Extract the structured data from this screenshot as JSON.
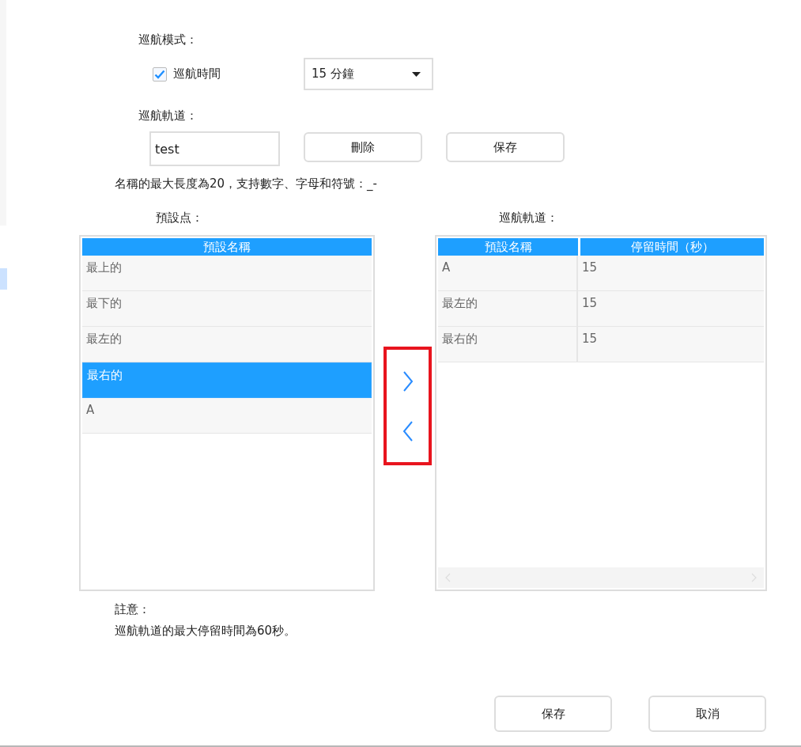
{
  "cruise_mode": {
    "label": "巡航模式：",
    "checkbox": {
      "label": "巡航時間",
      "checked": true
    },
    "duration": {
      "value": "15 分鐘"
    }
  },
  "cruise_track": {
    "label": "巡航軌道：",
    "name": {
      "value": "test"
    },
    "buttons": [
      "刪除",
      "保存"
    ],
    "hint": "名稱的最大長度為20，支持數字、字母和符號：_-"
  },
  "presets": {
    "label": "預設点：",
    "columns": [
      "預設名稱"
    ],
    "rows": [
      {
        "name": "最上的",
        "selected": false
      },
      {
        "name": "最下的",
        "selected": false
      },
      {
        "name": "最左的",
        "selected": false
      },
      {
        "name": "最右的",
        "selected": true
      },
      {
        "name": "A",
        "selected": false
      }
    ]
  },
  "track_table": {
    "label": "巡航軌道：",
    "columns": [
      "預設名稱",
      "停留時間（秒）"
    ],
    "rows": [
      {
        "cells": [
          "A",
          "15"
        ]
      },
      {
        "cells": [
          "最左的",
          "15"
        ]
      },
      {
        "cells": [
          "最右的",
          "15"
        ]
      }
    ]
  },
  "note": {
    "title": "註意：",
    "text": "巡航軌道的最大停留時間為60秒。"
  },
  "footer_buttons": [
    "保存",
    "取消"
  ]
}
